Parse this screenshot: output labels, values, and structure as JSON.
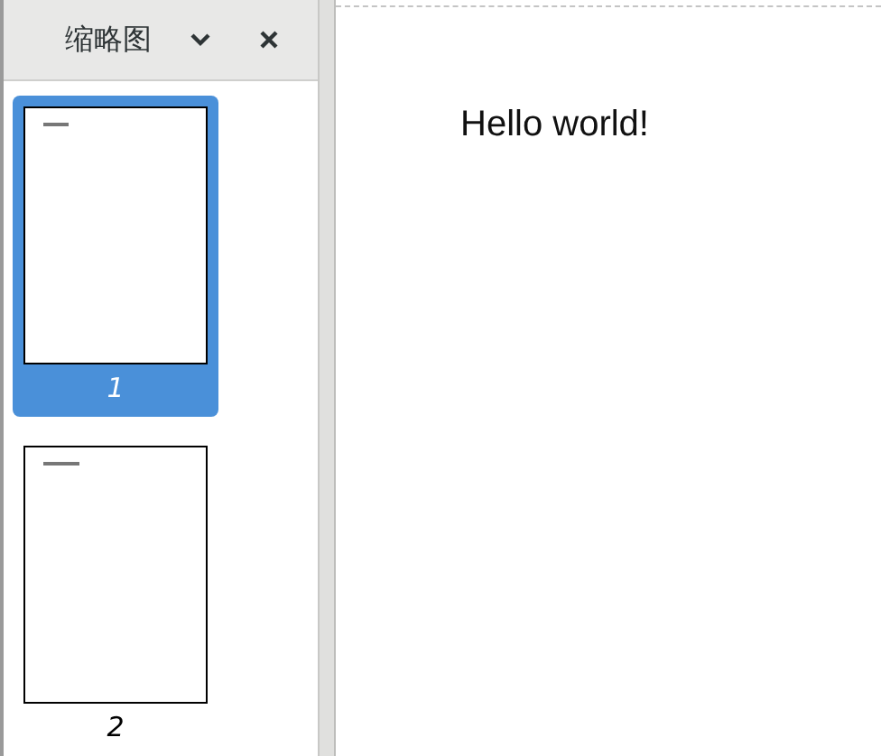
{
  "sidebar": {
    "title": "缩略图",
    "thumbnails": [
      {
        "label": "1",
        "selected": true
      },
      {
        "label": "2",
        "selected": false
      }
    ]
  },
  "document": {
    "text": "Hello world!"
  }
}
